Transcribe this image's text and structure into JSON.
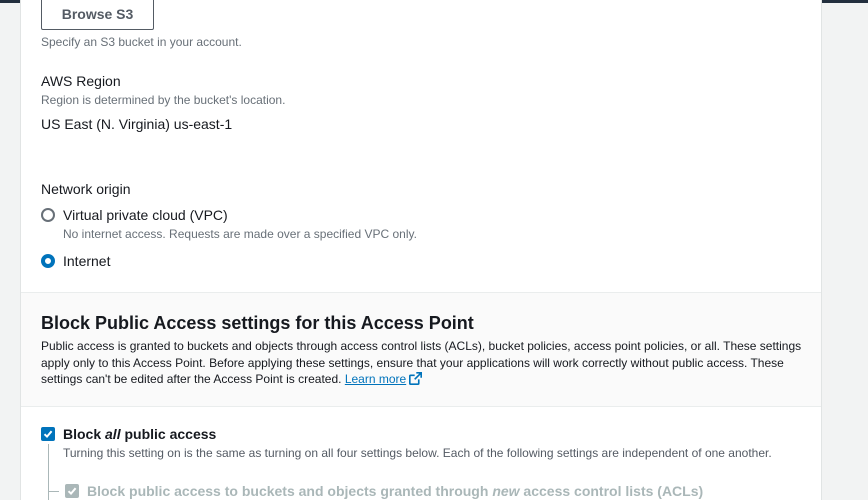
{
  "s3": {
    "browse_label": "Browse S3",
    "hint": "Specify an S3 bucket in your account."
  },
  "region": {
    "label": "AWS Region",
    "hint": "Region is determined by the bucket's location.",
    "value": "US East (N. Virginia) us-east-1"
  },
  "network": {
    "label": "Network origin",
    "options": [
      {
        "label": "Virtual private cloud (VPC)",
        "description": "No internet access. Requests are made over a specified VPC only.",
        "selected": false
      },
      {
        "label": "Internet",
        "description": "",
        "selected": true
      }
    ]
  },
  "bpa": {
    "title": "Block Public Access settings for this Access Point",
    "description": "Public access is granted to buckets and objects through access control lists (ACLs), bucket policies, access point policies, or all. These settings apply only to this Access Point. Before applying these settings, ensure that your applications will work correctly without public access. These settings can't be edited after the Access Point is created.",
    "learn_more": "Learn more",
    "block_all": {
      "prefix": "Block ",
      "emphasis": "all",
      "suffix": " public access",
      "checked": true,
      "description": "Turning this setting on is the same as turning on all four settings below. Each of the following settings are independent of one another."
    },
    "sub_settings": [
      {
        "prefix": "Block public access to buckets and objects granted through ",
        "emphasis": "new",
        "suffix": " access control lists (ACLs)",
        "checked": true,
        "disabled": true
      }
    ]
  },
  "colors": {
    "accent": "#0073bb",
    "disabled": "#aab7b8",
    "top_bar": "#232f3e"
  }
}
